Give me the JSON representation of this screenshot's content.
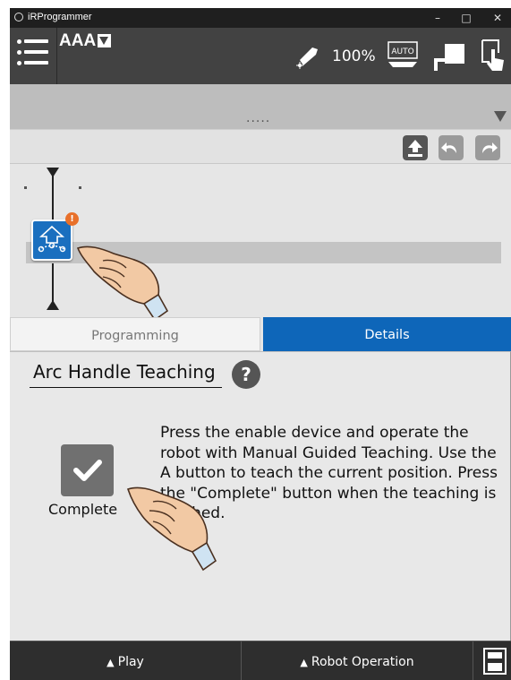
{
  "window": {
    "title": "iRProgrammer",
    "minimize": "–",
    "maximize": "□",
    "close": "✕"
  },
  "toolbar": {
    "program_name": "AAA",
    "speed": "100%",
    "mode_badge": "AUTO"
  },
  "editor": {
    "dots": "....."
  },
  "timeline": {
    "badge": "!"
  },
  "tabs": {
    "programming": "Programming",
    "details": "Details"
  },
  "details": {
    "title": "Arc Handle Teaching",
    "help": "?",
    "complete_label": "Complete",
    "instructions": "Press the enable device and operate the robot with Manual Guided Teaching. Use the A button to teach the current position. Press the \"Complete\" button when the teaching is finished."
  },
  "bottom_bar": {
    "play": "Play",
    "robot_operation": "Robot Operation"
  },
  "colors": {
    "accent": "#0e66b9",
    "toolbar": "#424242",
    "badge": "#e8702a"
  },
  "icons": [
    "menu-icon",
    "dropdown-caret-icon",
    "torch-icon",
    "auto-mode-icon",
    "teach-pendant-icon",
    "touch-mode-icon",
    "upload-icon",
    "undo-icon",
    "redo-icon",
    "arc-teaching-command-icon",
    "help-icon",
    "checkmark-icon",
    "play-triangle-icon",
    "save-station-icon",
    "pointing-hand-icon"
  ]
}
